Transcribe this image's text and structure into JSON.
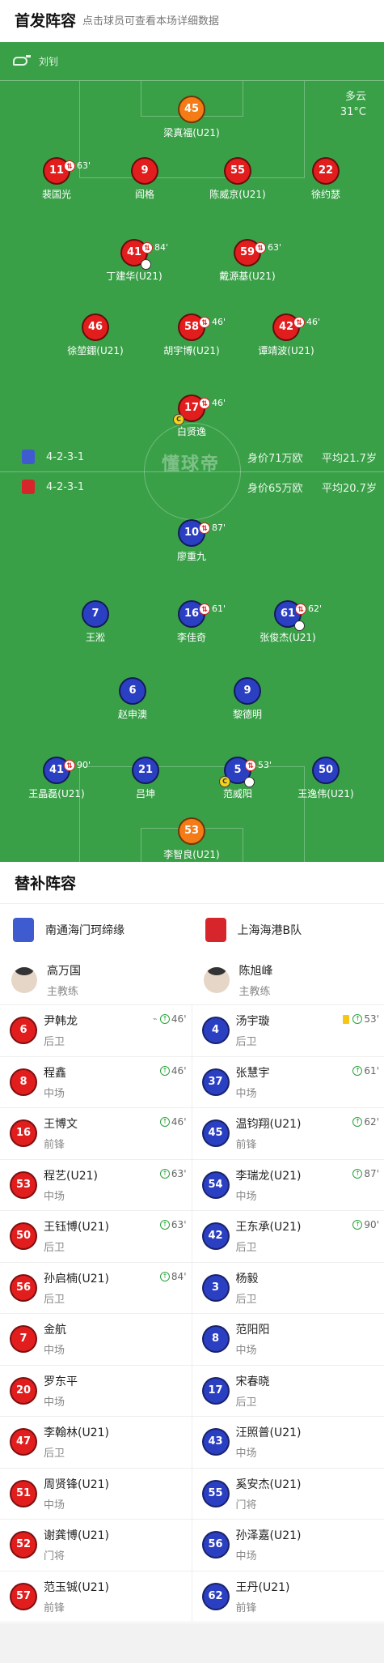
{
  "header": {
    "title": "首发阵容",
    "subtitle": "点击球员可查看本场详细数据"
  },
  "referee": {
    "name": "刘钊"
  },
  "weather": {
    "condition": "多云",
    "temperature": "31°C"
  },
  "watermark": "懂球帝",
  "colors": {
    "pitch": "#3aa048",
    "home": "#e21d1d",
    "away": "#2b3fc2",
    "goalkeeper": "#f47b16"
  },
  "teams": {
    "home": {
      "name": "南通海门珂缔缘",
      "formation": "4-2-3-1",
      "value": "身价71万欧",
      "avg_age": "平均21.7岁",
      "crest_color": "#3f5bd0"
    },
    "away": {
      "name": "上海海港B队",
      "formation": "4-2-3-1",
      "value": "身价65万欧",
      "avg_age": "平均20.7岁",
      "crest_color": "#d7262b"
    }
  },
  "lineup": {
    "top": [
      {
        "number": "45",
        "name": "梁真福(U21)",
        "color": "orange"
      },
      {
        "number": "11",
        "name": "裴国光",
        "color": "red",
        "sub_min": "63'"
      },
      {
        "number": "9",
        "name": "阎格",
        "color": "red"
      },
      {
        "number": "55",
        "name": "陈威京(U21)",
        "color": "red"
      },
      {
        "number": "22",
        "name": "徐约瑟",
        "color": "red"
      },
      {
        "number": "41",
        "name": "丁建华(U21)",
        "color": "red",
        "sub_min": "84'",
        "goal": true
      },
      {
        "number": "59",
        "name": "戴源基(U21)",
        "color": "red",
        "sub_min": "63'"
      },
      {
        "number": "46",
        "name": "徐堃錋(U21)",
        "color": "red"
      },
      {
        "number": "58",
        "name": "胡宇博(U21)",
        "color": "red",
        "sub_min": "46'"
      },
      {
        "number": "42",
        "name": "谭靖波(U21)",
        "color": "red",
        "sub_min": "46'"
      },
      {
        "number": "17",
        "name": "白贤逸",
        "color": "red",
        "sub_min": "46'",
        "captain": true
      }
    ],
    "bottom": [
      {
        "number": "10",
        "name": "廖重九",
        "color": "blue",
        "sub_min": "87'"
      },
      {
        "number": "7",
        "name": "王淞",
        "color": "blue"
      },
      {
        "number": "16",
        "name": "李佳奇",
        "color": "blue",
        "sub_min": "61'"
      },
      {
        "number": "61",
        "name": "张俊杰(U21)",
        "color": "blue",
        "sub_min": "62'",
        "goal": true
      },
      {
        "number": "6",
        "name": "赵申澳",
        "color": "blue"
      },
      {
        "number": "9",
        "name": "黎德明",
        "color": "blue"
      },
      {
        "number": "41",
        "name": "王晶磊(U21)",
        "color": "blue",
        "sub_min": "90'"
      },
      {
        "number": "21",
        "name": "吕坤",
        "color": "blue"
      },
      {
        "number": "5",
        "name": "范威阳",
        "color": "blue",
        "sub_min": "53'",
        "captain": true,
        "goal": true
      },
      {
        "number": "50",
        "name": "王逸伟(U21)",
        "color": "blue"
      },
      {
        "number": "53",
        "name": "李智良(U21)",
        "color": "orange"
      }
    ]
  },
  "subs_title": "替补阵容",
  "coaches": {
    "home": {
      "name": "高万国",
      "role": "主教练"
    },
    "away": {
      "name": "陈旭峰",
      "role": "主教练"
    }
  },
  "bench": {
    "home": [
      {
        "number": "6",
        "name": "尹韩龙",
        "position": "后卫",
        "minute": "46'",
        "assist": true
      },
      {
        "number": "8",
        "name": "程鑫",
        "position": "中场",
        "minute": "46'"
      },
      {
        "number": "16",
        "name": "王博文",
        "position": "前锋",
        "minute": "46'"
      },
      {
        "number": "53",
        "name": "程艺(U21)",
        "position": "中场",
        "minute": "63'"
      },
      {
        "number": "50",
        "name": "王钰博(U21)",
        "position": "后卫",
        "minute": "63'"
      },
      {
        "number": "56",
        "name": "孙启楠(U21)",
        "position": "后卫",
        "minute": "84'"
      },
      {
        "number": "7",
        "name": "金航",
        "position": "中场"
      },
      {
        "number": "20",
        "name": "罗东平",
        "position": "中场"
      },
      {
        "number": "47",
        "name": "李翰林(U21)",
        "position": "后卫"
      },
      {
        "number": "51",
        "name": "周贤锋(U21)",
        "position": "中场"
      },
      {
        "number": "52",
        "name": "谢龚博(U21)",
        "position": "门将"
      },
      {
        "number": "57",
        "name": "范玉铖(U21)",
        "position": "前锋"
      }
    ],
    "away": [
      {
        "number": "4",
        "name": "汤宇璇",
        "position": "后卫",
        "minute": "53'",
        "yellow": true
      },
      {
        "number": "37",
        "name": "张慧宇",
        "position": "中场",
        "minute": "61'"
      },
      {
        "number": "45",
        "name": "温钧翔(U21)",
        "position": "前锋",
        "minute": "62'"
      },
      {
        "number": "54",
        "name": "李瑞龙(U21)",
        "position": "中场",
        "minute": "87'"
      },
      {
        "number": "42",
        "name": "王东承(U21)",
        "position": "后卫",
        "minute": "90'"
      },
      {
        "number": "3",
        "name": "杨毅",
        "position": "后卫"
      },
      {
        "number": "8",
        "name": "范阳阳",
        "position": "中场"
      },
      {
        "number": "17",
        "name": "宋春晓",
        "position": "后卫"
      },
      {
        "number": "43",
        "name": "汪照普(U21)",
        "position": "中场"
      },
      {
        "number": "55",
        "name": "奚安杰(U21)",
        "position": "门将"
      },
      {
        "number": "56",
        "name": "孙泽嘉(U21)",
        "position": "中场"
      },
      {
        "number": "62",
        "name": "王丹(U21)",
        "position": "前锋"
      }
    ]
  }
}
